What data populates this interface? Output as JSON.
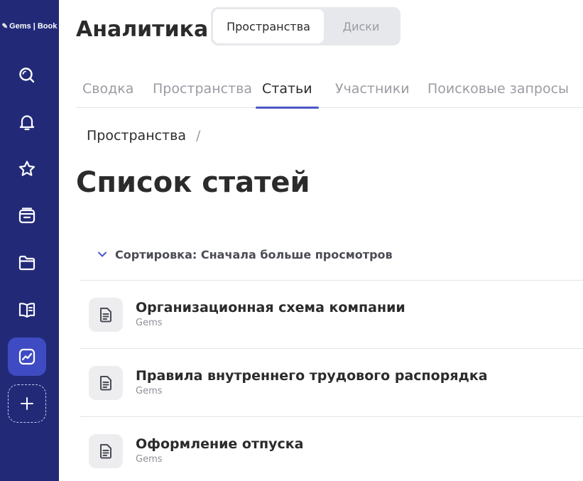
{
  "sidebar": {
    "logo_text": "Gems | Book",
    "items": [
      {
        "icon": "search-icon"
      },
      {
        "icon": "bell-icon"
      },
      {
        "icon": "star-icon"
      },
      {
        "icon": "inbox-icon"
      },
      {
        "icon": "folder-icon"
      },
      {
        "icon": "book-icon"
      },
      {
        "icon": "analytics-icon",
        "active": true
      },
      {
        "icon": "plus-icon"
      }
    ]
  },
  "header": {
    "title": "Аналитика",
    "segments": [
      {
        "label": "Пространства",
        "selected": true
      },
      {
        "label": "Диски",
        "selected": false
      }
    ]
  },
  "tabs": [
    {
      "label": "Сводка",
      "active": false
    },
    {
      "label": "Пространства",
      "active": false
    },
    {
      "label": "Статьи",
      "active": true
    },
    {
      "label": "Участники",
      "active": false
    },
    {
      "label": "Поисковые запросы",
      "active": false
    }
  ],
  "breadcrumb": {
    "item": "Пространства",
    "separator": "/"
  },
  "page": {
    "title": "Список статей",
    "sort_label": "Сортировка: Сначала больше просмотров"
  },
  "articles": [
    {
      "title": "Организационная схема компании",
      "space": "Gems"
    },
    {
      "title": "Правила внутреннего трудового распорядка",
      "space": "Gems"
    },
    {
      "title": "Оформление отпуска",
      "space": "Gems"
    }
  ],
  "colors": {
    "sidebar_bg": "#222a78",
    "active_nav": "#3f4bc2",
    "tab_underline": "#4b56c6"
  }
}
